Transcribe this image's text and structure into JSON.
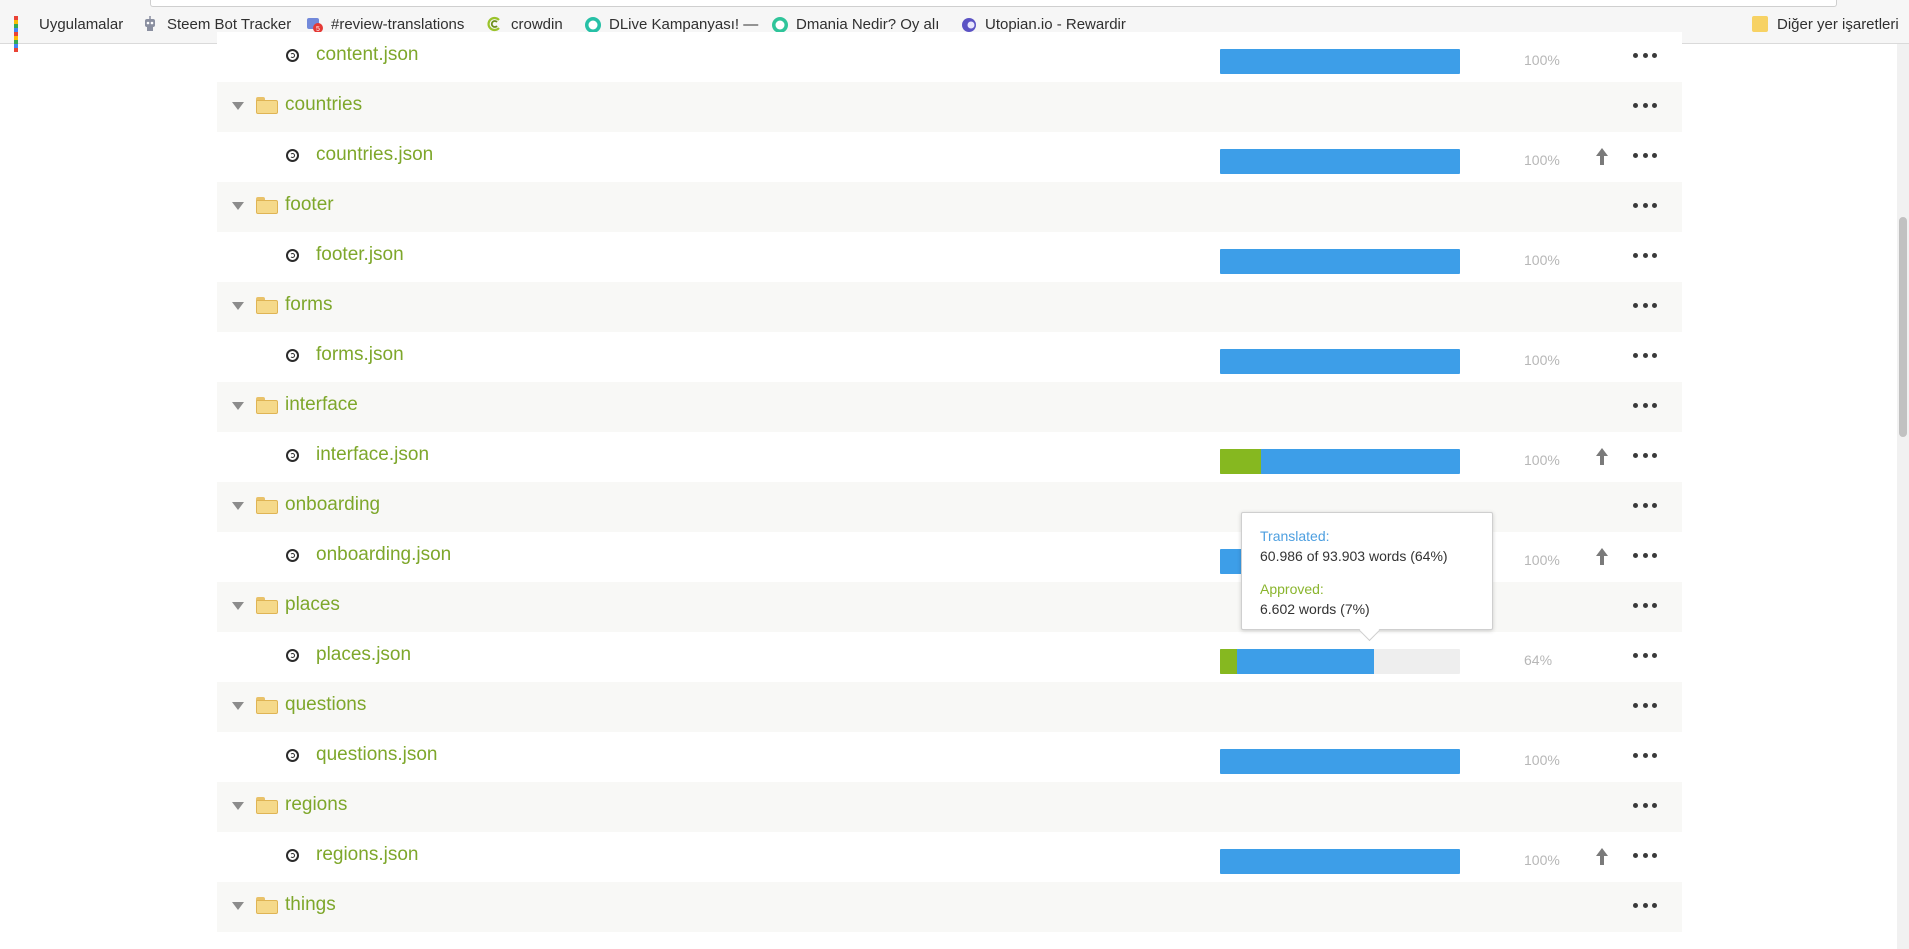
{
  "bookmarks": [
    {
      "label": "Uygulamalar",
      "icon": "apps-grid-icon"
    },
    {
      "label": "Steem Bot Tracker",
      "icon": "robot-icon"
    },
    {
      "label": "#review-translations",
      "icon": "discord-icon"
    },
    {
      "label": "crowdin",
      "icon": "crowdin-icon"
    },
    {
      "label": "DLive Kampanyası! —",
      "icon": "dlive-icon"
    },
    {
      "label": "Dmania Nedir? Oy alı",
      "icon": "dmania-icon"
    },
    {
      "label": "Utopian.io - Rewardir",
      "icon": "utopian-icon"
    }
  ],
  "other_bookmarks": "Diğer yer işaretleri",
  "rows": [
    {
      "kind": "file",
      "name": "content.json",
      "translated": 1.0,
      "approved": 0.0,
      "pct": "100%",
      "upload": false
    },
    {
      "kind": "folder",
      "name": "countries"
    },
    {
      "kind": "file",
      "name": "countries.json",
      "translated": 1.0,
      "approved": 0.0,
      "pct": "100%",
      "upload": true
    },
    {
      "kind": "folder",
      "name": "footer"
    },
    {
      "kind": "file",
      "name": "footer.json",
      "translated": 1.0,
      "approved": 0.0,
      "pct": "100%",
      "upload": false
    },
    {
      "kind": "folder",
      "name": "forms"
    },
    {
      "kind": "file",
      "name": "forms.json",
      "translated": 1.0,
      "approved": 0.0,
      "pct": "100%",
      "upload": false
    },
    {
      "kind": "folder",
      "name": "interface"
    },
    {
      "kind": "file",
      "name": "interface.json",
      "translated": 1.0,
      "approved": 0.17,
      "pct": "100%",
      "upload": true
    },
    {
      "kind": "folder",
      "name": "onboarding"
    },
    {
      "kind": "file",
      "name": "onboarding.json",
      "translated": 1.0,
      "approved": 0.0,
      "pct": "100%",
      "upload": true
    },
    {
      "kind": "folder",
      "name": "places"
    },
    {
      "kind": "file",
      "name": "places.json",
      "translated": 0.64,
      "approved": 0.07,
      "pct": "64%",
      "upload": false
    },
    {
      "kind": "folder",
      "name": "questions"
    },
    {
      "kind": "file",
      "name": "questions.json",
      "translated": 1.0,
      "approved": 0.0,
      "pct": "100%",
      "upload": false
    },
    {
      "kind": "folder",
      "name": "regions"
    },
    {
      "kind": "file",
      "name": "regions.json",
      "translated": 1.0,
      "approved": 0.0,
      "pct": "100%",
      "upload": true
    },
    {
      "kind": "folder",
      "name": "things"
    }
  ],
  "tooltip": {
    "translated_label": "Translated:",
    "translated_value": "60.986 of 93.903 words (64%)",
    "approved_label": "Approved:",
    "approved_value": "6.602 words (7%)"
  },
  "colors": {
    "link_green": "#7ea72b",
    "translated_blue": "#3d9ee8",
    "approved_green": "#86b820",
    "tooltip_blue": "#4d9fe0",
    "tooltip_green": "#8ab52d"
  }
}
